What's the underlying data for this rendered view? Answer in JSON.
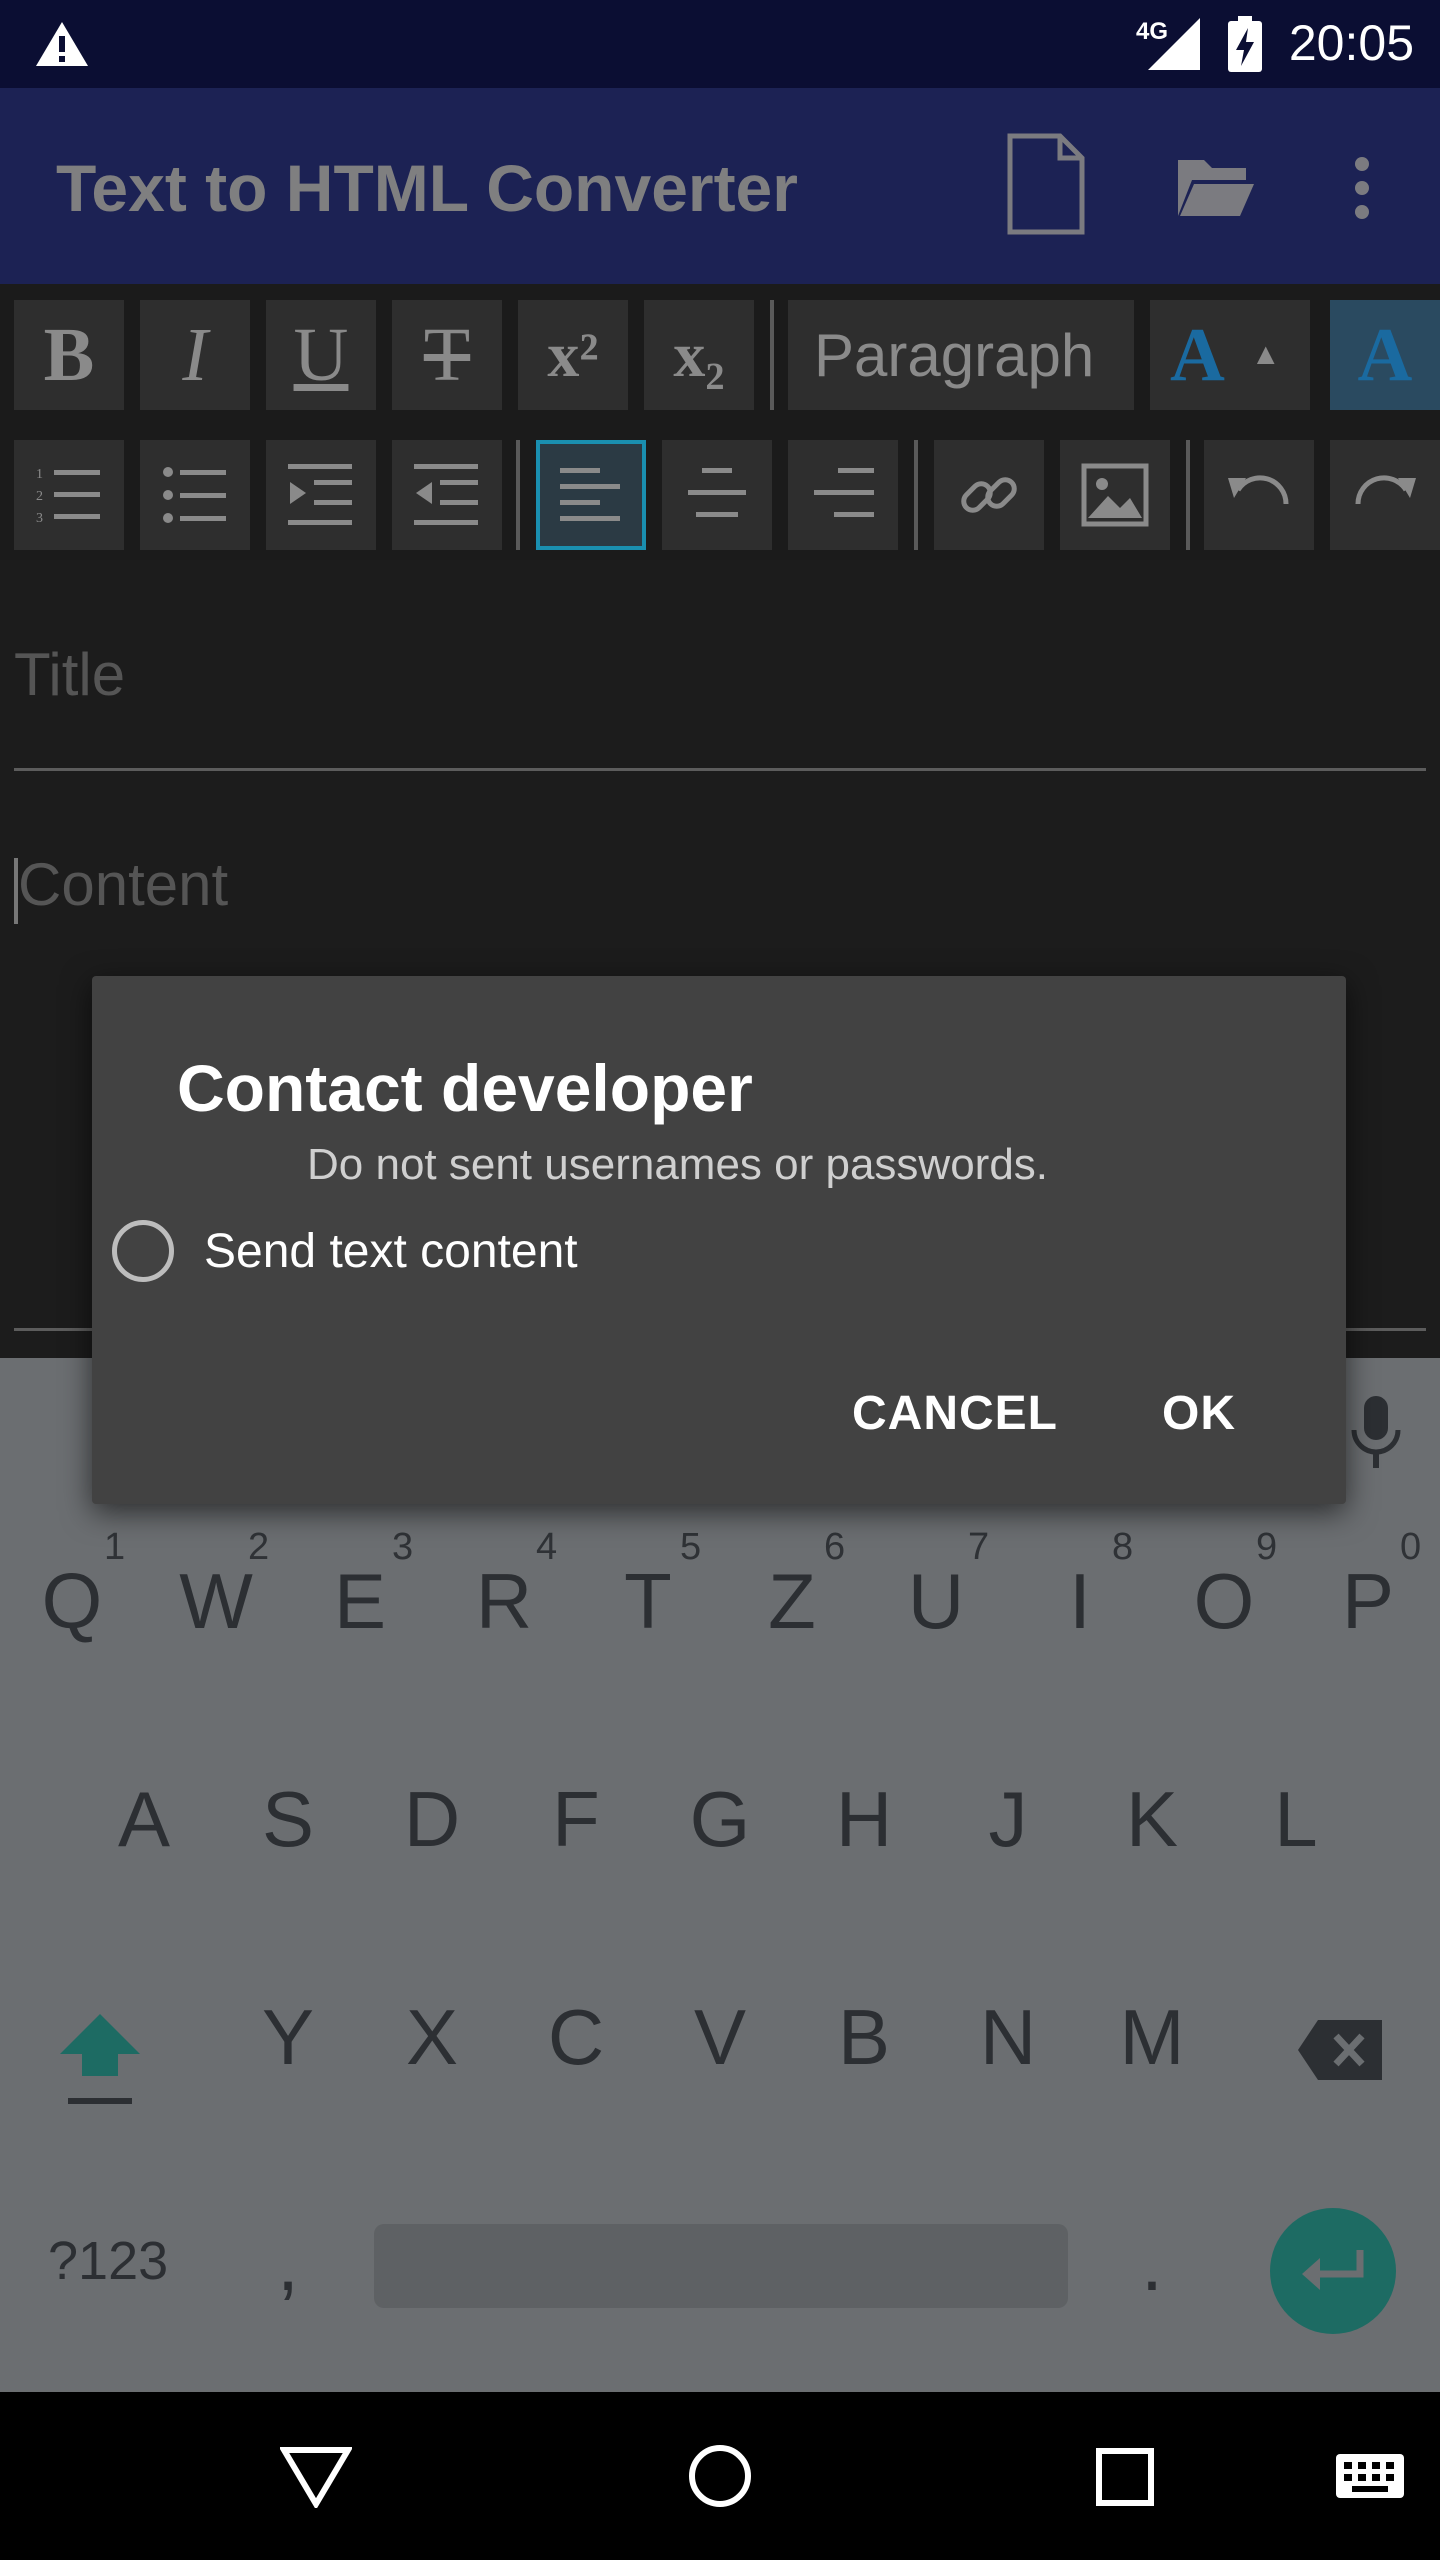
{
  "status_bar": {
    "time": "20:05",
    "network": "4G",
    "warning_icon": "warning-icon",
    "signal_icon": "signal-icon",
    "battery_icon": "battery-charging-icon"
  },
  "app_bar": {
    "title": "Text to HTML Converter",
    "actions": [
      "new-document-icon",
      "open-folder-icon",
      "more-vert-icon"
    ]
  },
  "toolbar": {
    "row1": [
      "B",
      "I",
      "U",
      "T",
      "x²",
      "x₂"
    ],
    "paragraph_label": "Paragraph",
    "row2_icons": [
      "ordered-list-icon",
      "bullet-list-icon",
      "indent-icon",
      "outdent-icon",
      "align-left-icon",
      "align-center-icon",
      "align-right-icon",
      "link-icon",
      "image-icon",
      "undo-icon",
      "redo-icon"
    ]
  },
  "editor": {
    "title_placeholder": "Title",
    "content_placeholder": "Content"
  },
  "dialog": {
    "title": "Contact developer",
    "message": "Do not sent usernames or passwords.",
    "checkbox_label": "Send text content",
    "cancel_label": "CANCEL",
    "ok_label": "OK"
  },
  "keyboard": {
    "row1": [
      "Q",
      "W",
      "E",
      "R",
      "T",
      "Z",
      "U",
      "I",
      "O",
      "P"
    ],
    "row1_hints": [
      "1",
      "2",
      "3",
      "4",
      "5",
      "6",
      "7",
      "8",
      "9",
      "0"
    ],
    "row2": [
      "A",
      "S",
      "D",
      "F",
      "G",
      "H",
      "J",
      "K",
      "L"
    ],
    "row3": [
      "Y",
      "X",
      "C",
      "V",
      "B",
      "N",
      "M"
    ],
    "symbols_label": "?123",
    "comma": ",",
    "period": "."
  },
  "colors": {
    "app_bar": "#1c2254",
    "status_bar": "#0b0e33",
    "dialog": "#424242",
    "accent": "#1a8fb0",
    "enter_key": "#1d6b63"
  }
}
